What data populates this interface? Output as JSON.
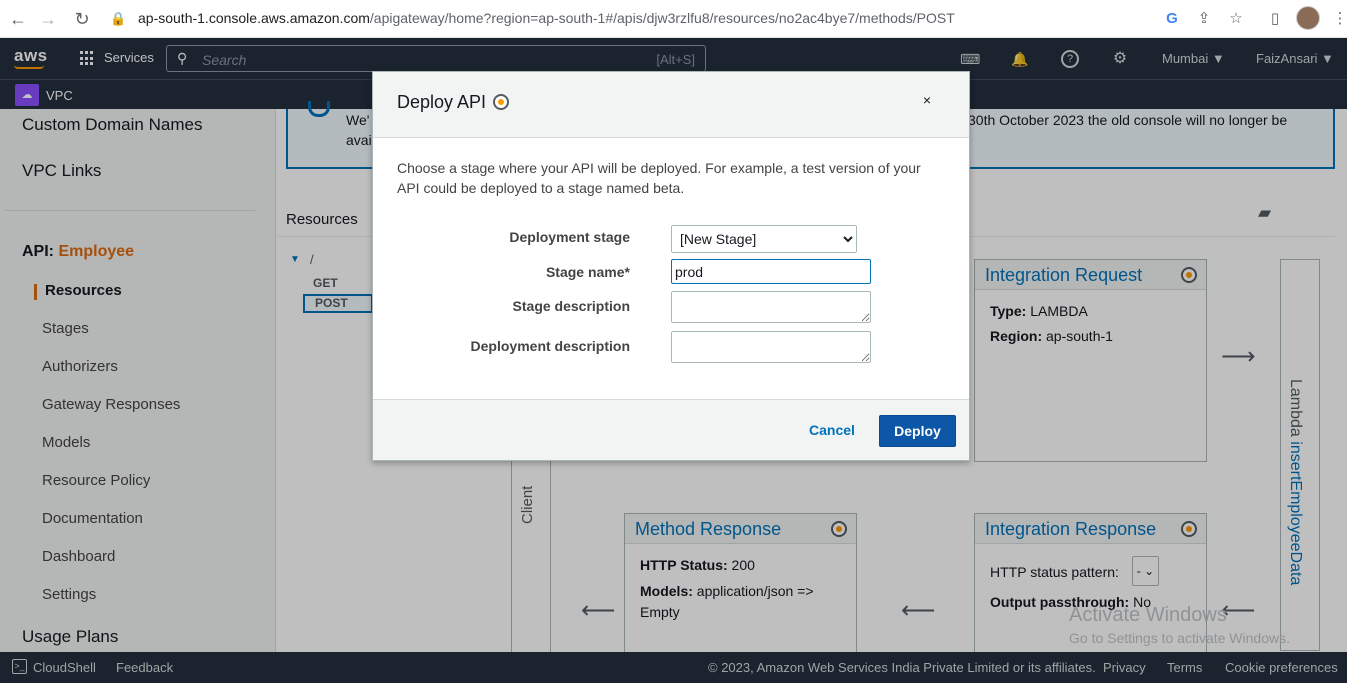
{
  "browser": {
    "url_host": "ap-south-1.console.aws.amazon.com",
    "url_path": "/apigateway/home?region=ap-south-1#/apis/djw3rzlfu8/resources/no2ac4bye7/methods/POST"
  },
  "topnav": {
    "logo": "aws",
    "services": "Services",
    "search_placeholder": "Search",
    "search_shortcut": "[Alt+S]",
    "region": "Mumbai ▼",
    "user": "FaizAnsari ▼"
  },
  "subnav": {
    "service": "VPC"
  },
  "sidebar": {
    "custom_domain": "Custom Domain Names",
    "vpc_links": "VPC Links",
    "api_prefix": "API:",
    "api_name": "Employee",
    "items": [
      "Resources",
      "Stages",
      "Authorizers",
      "Gateway Responses",
      "Models",
      "Resource Policy",
      "Documentation",
      "Dashboard",
      "Settings"
    ],
    "usage_plans": "Usage Plans"
  },
  "banner": {
    "text_left": "We'",
    "text_left2": "avai",
    "text_right": "30th October 2023 the old console will no longer be"
  },
  "main": {
    "resources_title": "Resources",
    "tree_root": "/",
    "tree_get": "GET",
    "tree_post": "POST",
    "client_label": "Client",
    "integration_request": {
      "title": "Integration Request",
      "type_label": "Type:",
      "type_value": "LAMBDA",
      "region_label": "Region:",
      "region_value": "ap-south-1"
    },
    "method_response": {
      "title": "Method Response",
      "status_label": "HTTP Status:",
      "status_value": "200",
      "models_label": "Models:",
      "models_value": "application/json =>",
      "models_value2": "Empty"
    },
    "integration_response": {
      "title": "Integration Response",
      "pattern_label": "HTTP status pattern:",
      "pattern_value": "-",
      "passthrough_label": "Output passthrough:",
      "passthrough_value": "No"
    },
    "lambda_prefix": "Lambda",
    "lambda_fn": "insertEmployeeData",
    "watermark_title": "Activate Windows",
    "watermark_sub": "Go to Settings to activate Windows."
  },
  "modal": {
    "title": "Deploy API",
    "close": "×",
    "description": "Choose a stage where your API will be deployed. For example, a test version of your API could be deployed to a stage named beta.",
    "deployment_stage_label": "Deployment stage",
    "deployment_stage_value": "[New Stage]",
    "stage_name_label": "Stage name*",
    "stage_name_value": "prod",
    "stage_description_label": "Stage description",
    "deployment_description_label": "Deployment description",
    "cancel": "Cancel",
    "deploy": "Deploy"
  },
  "footer": {
    "cloudshell": "CloudShell",
    "feedback": "Feedback",
    "copyright": "© 2023, Amazon Web Services India Private Limited or its affiliates.",
    "privacy": "Privacy",
    "terms": "Terms",
    "cookies": "Cookie preferences"
  }
}
